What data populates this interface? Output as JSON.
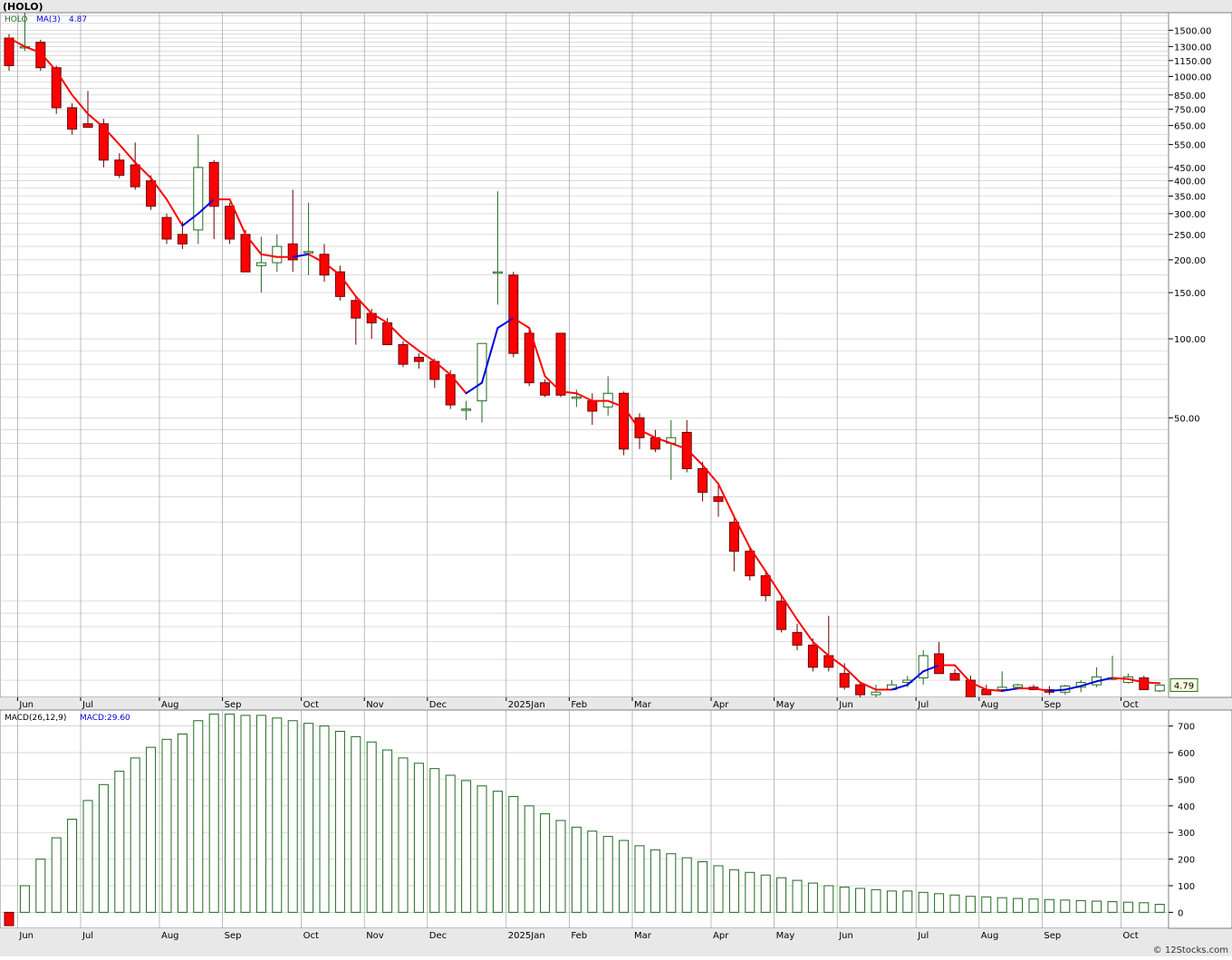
{
  "header": {
    "title": "(HOLO)"
  },
  "colors": {
    "up": "#1f6b1f",
    "down_fill": "#ff0000",
    "down_edge": "#660000",
    "ma_down": "#ff0000",
    "ma_up": "#0000dd",
    "macd_bar": "#1f6b1f",
    "grid": "#c8c8c8",
    "frame": "#808080",
    "bg": "#ffffff",
    "panel_bg": "#f0f0f0"
  },
  "main_panel": {
    "symbol_label": "HOLO",
    "ma_label": "MA(3)",
    "ma_value": "4.87",
    "last_price": "4.79",
    "y_ticks": [
      "1500.00",
      "1300.00",
      "1150.00",
      "1000.00",
      "850.00",
      "750.00",
      "650.00",
      "550.00",
      "450.00",
      "400.00",
      "350.00",
      "300.00",
      "250.00",
      "200.00",
      "150.00",
      "100.00",
      "50.00"
    ]
  },
  "macd_panel": {
    "label": "MACD(26,12,9)",
    "value_label": "MACD:29.60",
    "y_ticks": [
      "700",
      "600",
      "500",
      "400",
      "300",
      "200",
      "100",
      "0"
    ]
  },
  "x_axis_labels": [
    "Jun",
    "Jul",
    "Aug",
    "Sep",
    "Oct",
    "Nov",
    "Dec",
    "2025Jan",
    "Feb",
    "Mar",
    "Apr",
    "May",
    "Jun",
    "Jul",
    "Aug",
    "Sep",
    "Oct"
  ],
  "footer": {
    "watermark": "© 12Stocks.com"
  },
  "chart_data": [
    {
      "type": "candlestick",
      "title": "(HOLO)",
      "scale": "log",
      "ylim": [
        4.3,
        1750
      ],
      "x_labels": [
        "Jun",
        "Jul",
        "Aug",
        "Sep",
        "Oct",
        "Nov",
        "Dec",
        "2025Jan",
        "Feb",
        "Mar",
        "Apr",
        "May",
        "Jun",
        "Jul",
        "Aug",
        "Sep",
        "Oct"
      ],
      "series": [
        {
          "name": "HOLO",
          "ohlc": [
            [
              1400,
              1450,
              1050,
              1100
            ],
            [
              1300,
              1750,
              1250,
              1300
            ],
            [
              1350,
              1380,
              1050,
              1080
            ],
            [
              1080,
              1100,
              720,
              760
            ],
            [
              760,
              790,
              600,
              630
            ],
            [
              660,
              880,
              650,
              640
            ],
            [
              660,
              690,
              450,
              480
            ],
            [
              480,
              510,
              410,
              420
            ],
            [
              460,
              560,
              370,
              380
            ],
            [
              400,
              420,
              310,
              320
            ],
            [
              290,
              300,
              230,
              240
            ],
            [
              250,
              280,
              220,
              230
            ],
            [
              260,
              600,
              230,
              450
            ],
            [
              470,
              480,
              240,
              320
            ],
            [
              320,
              330,
              230,
              240
            ],
            [
              250,
              260,
              180,
              180
            ],
            [
              190,
              245,
              150,
              195
            ],
            [
              195,
              250,
              180,
              225
            ],
            [
              230,
              370,
              180,
              200
            ],
            [
              215,
              330,
              175,
              215
            ],
            [
              210,
              230,
              165,
              175
            ],
            [
              180,
              190,
              140,
              145
            ],
            [
              140,
              145,
              95,
              120
            ],
            [
              125,
              130,
              100,
              115
            ],
            [
              115,
              120,
              95,
              95
            ],
            [
              95,
              98,
              78,
              80
            ],
            [
              85,
              88,
              77,
              82
            ],
            [
              82,
              84,
              65,
              70
            ],
            [
              73,
              76,
              54,
              56
            ],
            [
              54,
              58,
              49,
              54
            ],
            [
              58,
              96,
              48,
              96
            ],
            [
              180,
              365,
              135,
              180
            ],
            [
              175,
              180,
              85,
              88
            ],
            [
              105,
              110,
              66,
              68
            ],
            [
              68,
              70,
              60,
              61
            ],
            [
              105,
              105,
              60,
              61
            ],
            [
              60,
              64,
              55,
              60
            ],
            [
              58,
              62,
              47,
              53
            ],
            [
              55,
              72,
              51,
              62
            ],
            [
              62,
              63,
              36,
              38
            ],
            [
              50,
              52,
              38,
              42
            ],
            [
              42,
              45,
              37,
              38
            ],
            [
              40,
              49,
              29,
              42
            ],
            [
              44,
              49,
              31,
              32
            ],
            [
              32,
              34,
              24,
              26
            ],
            [
              25,
              28,
              21,
              24
            ],
            [
              20,
              21,
              13,
              15.5
            ],
            [
              15.5,
              16,
              12,
              12.5
            ],
            [
              12.5,
              13,
              10,
              10.5
            ],
            [
              10,
              10.5,
              7.6,
              7.8
            ],
            [
              7.6,
              8.2,
              6.5,
              6.8
            ],
            [
              6.8,
              7.2,
              5.4,
              5.6
            ],
            [
              6.2,
              8.8,
              5.4,
              5.6
            ],
            [
              5.3,
              5.8,
              4.6,
              4.7
            ],
            [
              4.8,
              4.9,
              4.3,
              4.4
            ],
            [
              4.4,
              4.8,
              4.2,
              4.5
            ],
            [
              4.6,
              5.0,
              4.6,
              4.8
            ],
            [
              4.9,
              5.2,
              4.7,
              5.0
            ],
            [
              5.1,
              6.5,
              4.8,
              6.2
            ],
            [
              6.3,
              7.0,
              5.3,
              5.3
            ],
            [
              5.3,
              5.5,
              5.0,
              5.0
            ],
            [
              5.0,
              5.2,
              4.3,
              4.3
            ],
            [
              4.6,
              4.8,
              4.4,
              4.4
            ],
            [
              4.6,
              5.4,
              4.5,
              4.7
            ],
            [
              4.7,
              4.85,
              4.6,
              4.8
            ],
            [
              4.7,
              4.8,
              4.6,
              4.6
            ],
            [
              4.6,
              4.75,
              4.4,
              4.5
            ],
            [
              4.5,
              4.8,
              4.4,
              4.75
            ],
            [
              4.7,
              5.0,
              4.5,
              4.9
            ],
            [
              4.8,
              5.6,
              4.7,
              5.15
            ],
            [
              5.1,
              6.2,
              5.0,
              5.1
            ],
            [
              4.9,
              5.3,
              4.85,
              5.15
            ],
            [
              5.1,
              5.2,
              4.6,
              4.6
            ],
            [
              4.55,
              4.8,
              4.5,
              4.79
            ]
          ]
        },
        {
          "name": "MA(3)",
          "values": [
            1400,
            1300,
            1230,
            1050,
            850,
            720,
            640,
            550,
            470,
            410,
            340,
            270,
            300,
            340,
            340,
            250,
            210,
            205,
            205,
            210,
            195,
            175,
            145,
            125,
            115,
            100,
            90,
            82,
            73,
            62,
            68,
            110,
            120,
            110,
            72,
            63,
            62,
            58,
            58,
            55,
            45,
            42,
            40,
            38,
            33,
            28,
            21,
            16,
            13,
            10.5,
            8.5,
            7,
            6.2,
            5.6,
            4.9,
            4.6,
            4.6,
            4.8,
            5.4,
            5.7,
            5.7,
            4.9,
            4.6,
            4.55,
            4.65,
            4.65,
            4.55,
            4.6,
            4.75,
            4.95,
            5.1,
            5.05,
            4.9,
            4.87
          ],
          "color_rule": "red when falling, blue when rising"
        }
      ]
    },
    {
      "type": "bar",
      "title": "MACD(26,12,9)",
      "ylim": [
        -60,
        760
      ],
      "x_labels": [
        "Jun",
        "Jul",
        "Aug",
        "Sep",
        "Oct",
        "Nov",
        "Dec",
        "2025Jan",
        "Feb",
        "Mar",
        "Apr",
        "May",
        "Jun",
        "Jul",
        "Aug",
        "Sep",
        "Oct"
      ],
      "series": [
        {
          "name": "MACD",
          "values": [
            -50,
            100,
            200,
            280,
            350,
            420,
            480,
            530,
            580,
            620,
            650,
            670,
            720,
            745,
            745,
            740,
            740,
            730,
            720,
            710,
            700,
            680,
            660,
            640,
            610,
            580,
            560,
            540,
            515,
            495,
            475,
            455,
            435,
            400,
            370,
            345,
            320,
            305,
            285,
            270,
            250,
            235,
            220,
            205,
            190,
            175,
            160,
            150,
            140,
            130,
            120,
            110,
            100,
            95,
            90,
            85,
            80,
            80,
            75,
            70,
            65,
            60,
            58,
            55,
            52,
            50,
            48,
            46,
            44,
            42,
            40,
            38,
            36,
            30
          ]
        }
      ]
    }
  ]
}
